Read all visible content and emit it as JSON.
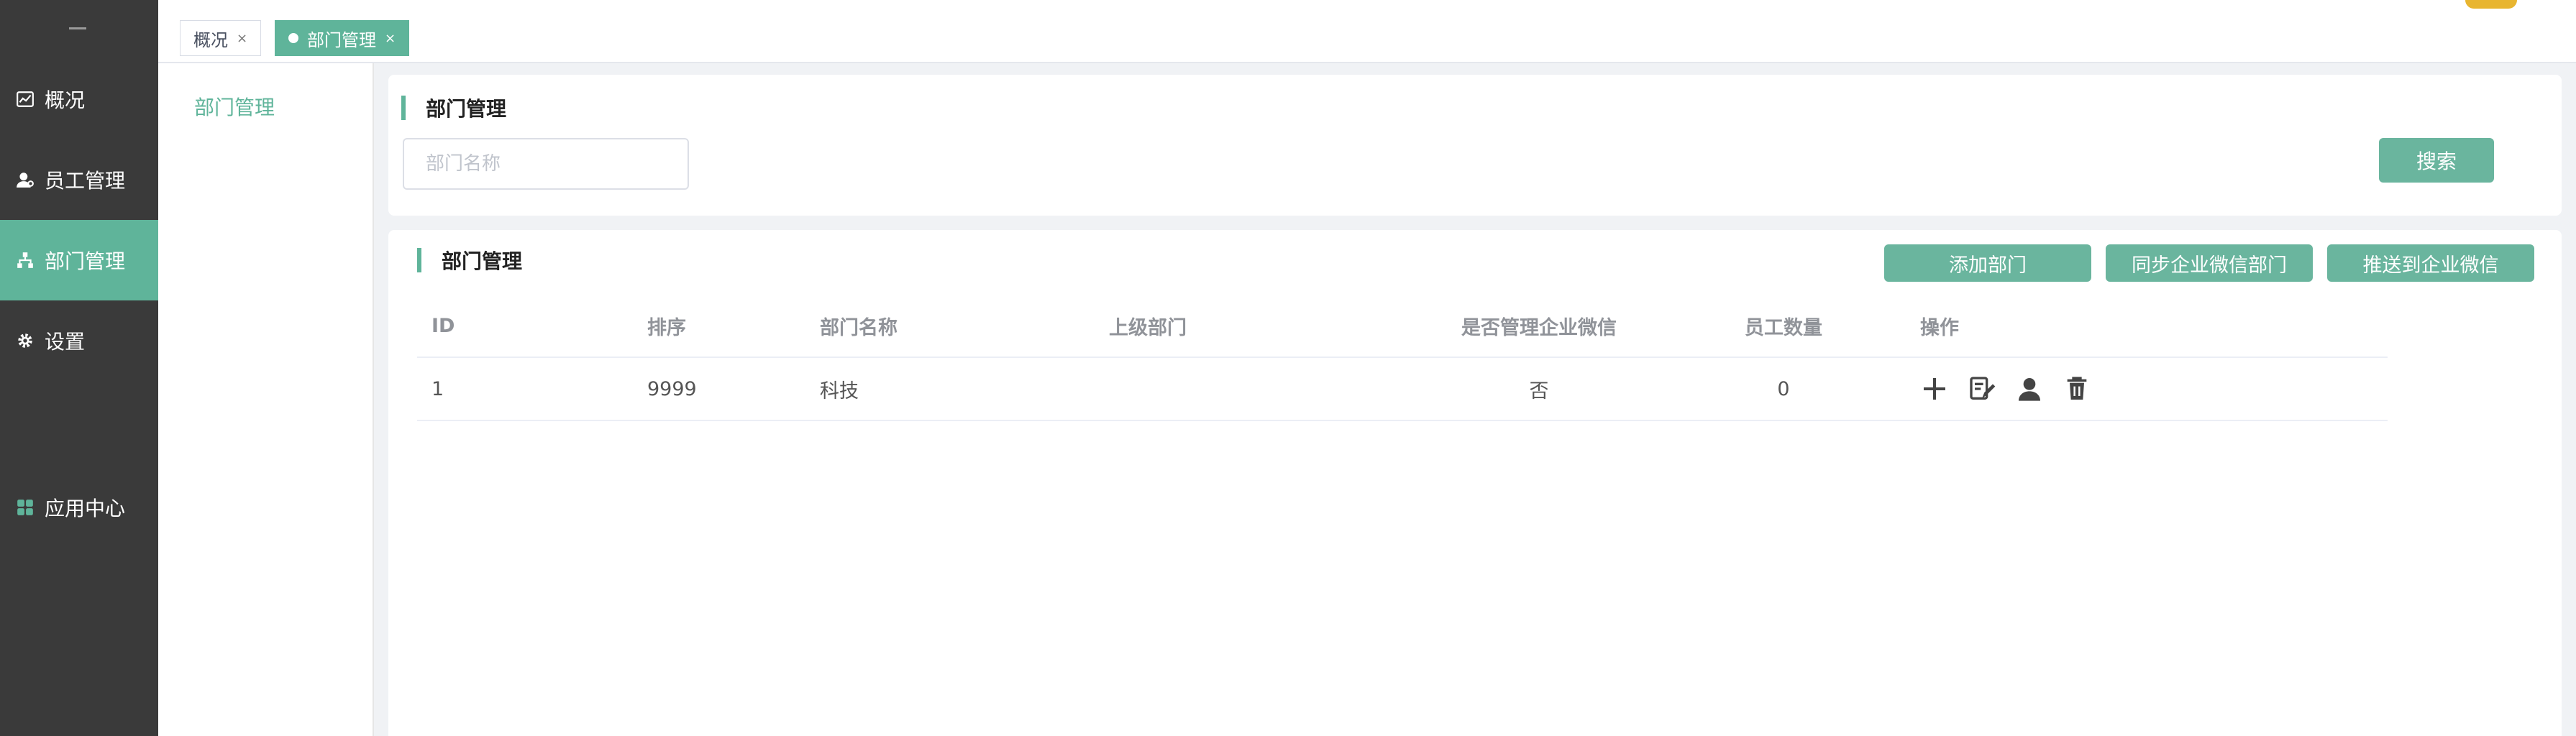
{
  "sidebar": {
    "items": [
      {
        "label": "概况",
        "icon": "chart-icon"
      },
      {
        "label": "员工管理",
        "icon": "user-icon"
      },
      {
        "label": "部门管理",
        "icon": "org-tree-icon"
      },
      {
        "label": "设置",
        "icon": "gear-icon"
      },
      {
        "label": "应用中心",
        "icon": "apps-grid-icon"
      }
    ],
    "active_index": 2
  },
  "tabs": [
    {
      "label": "概况",
      "close": "×"
    },
    {
      "label": "部门管理",
      "close": "×",
      "active": true
    }
  ],
  "subnav": {
    "items": [
      {
        "label": "部门管理"
      }
    ]
  },
  "search": {
    "title": "部门管理",
    "placeholder": "部门名称",
    "value": "",
    "button_label": "搜索"
  },
  "list": {
    "title": "部门管理",
    "buttons": {
      "add": "添加部门",
      "sync": "同步企业微信部门",
      "push": "推送到企业微信"
    },
    "columns": [
      "ID",
      "排序",
      "部门名称",
      "上级部门",
      "是否管理企业微信",
      "员工数量",
      "操作"
    ],
    "rows": [
      {
        "id": "1",
        "sort": "9999",
        "name": "科技",
        "parent": "",
        "manage_wx": "否",
        "count": "0",
        "actions": [
          "plus-icon",
          "edit-icon",
          "user-icon",
          "trash-icon"
        ]
      }
    ]
  },
  "colors": {
    "accent": "#5fb49a",
    "sidebar_bg": "#3a3a3a",
    "badge": "#e8b530"
  }
}
